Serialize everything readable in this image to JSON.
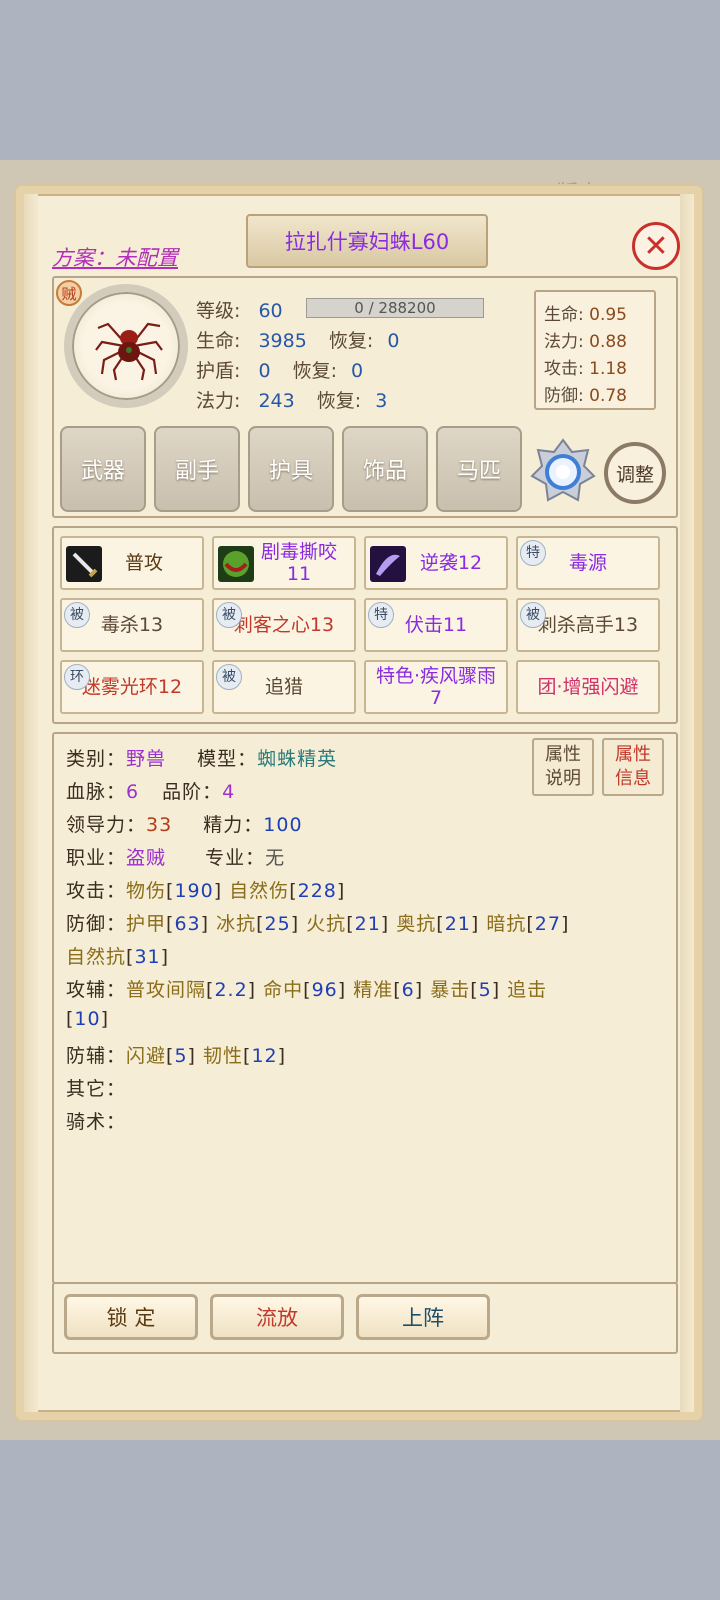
{
  "background": {
    "version_text": "版本0.0.0"
  },
  "header": {
    "plan_label": "方案：未配置",
    "title": "拉扎什寡妇蛛L60",
    "close_label": "✕"
  },
  "pet": {
    "role_badge": "贼",
    "level_label": "等级:",
    "level": "60",
    "exp_text": "0 / 288200",
    "hp_label": "生命:",
    "hp": "3985",
    "hp_regen_label": "恢复:",
    "hp_regen": "0",
    "shield_label": "护盾:",
    "shield": "0",
    "shield_regen_label": "恢复:",
    "shield_regen": "0",
    "mp_label": "法力:",
    "mp": "243",
    "mp_regen_label": "恢复:",
    "mp_regen": "3"
  },
  "growth": [
    {
      "label": "生命:",
      "value": "0.95"
    },
    {
      "label": "法力:",
      "value": "0.88"
    },
    {
      "label": "攻击:",
      "value": "1.18"
    },
    {
      "label": "防御:",
      "value": "0.78"
    }
  ],
  "equipment": {
    "slots": [
      "武器",
      "副手",
      "护具",
      "饰品",
      "马匹"
    ],
    "adjust_label": "调整"
  },
  "skills": [
    {
      "tag": "",
      "label": "普攻",
      "color": "#5c3a12"
    },
    {
      "tag": "",
      "label": "剧毒撕咬\n11",
      "color": "#8a2be2"
    },
    {
      "tag": "",
      "label": "逆袭12",
      "color": "#8a2be2"
    },
    {
      "tag": "特",
      "label": "毒源",
      "color": "#8a2be2"
    },
    {
      "tag": "被",
      "label": "毒杀13",
      "color": "#5c4a35"
    },
    {
      "tag": "被",
      "label": "刺客之心13",
      "color": "#c0392b"
    },
    {
      "tag": "特",
      "label": "伏击11",
      "color": "#8a2be2"
    },
    {
      "tag": "被",
      "label": "刺杀高手13",
      "color": "#5c4a35"
    },
    {
      "tag": "环",
      "label": "迷雾光环12",
      "color": "#c0392b"
    },
    {
      "tag": "被",
      "label": "追猎",
      "color": "#5c4a35"
    },
    {
      "tag": "",
      "label": "特色·疾风骤雨\n7",
      "color": "#8a2be2"
    },
    {
      "tag": "",
      "label": "团·增强闪避",
      "color": "#d0326a"
    }
  ],
  "attributes": {
    "category_label": "类别：",
    "category": "野兽",
    "model_label": "模型：",
    "model": "蜘蛛精英",
    "bloodline_label": "血脉：",
    "bloodline": "6",
    "rank_label": "品阶：",
    "rank": "4",
    "leadership_label": "领导力：",
    "leadership": "33",
    "energy_label": "精力：",
    "energy": "100",
    "class_label": "职业：",
    "class": "盗贼",
    "spec_label": "专业：",
    "spec": "无",
    "attack_label": "攻击：",
    "attack": [
      {
        "name": "物伤",
        "value": "190"
      },
      {
        "name": "自然伤",
        "value": "228"
      }
    ],
    "defense_label": "防御：",
    "defense": [
      {
        "name": "护甲",
        "value": "63"
      },
      {
        "name": "冰抗",
        "value": "25"
      },
      {
        "name": "火抗",
        "value": "21"
      },
      {
        "name": "奥抗",
        "value": "21"
      },
      {
        "name": "暗抗",
        "value": "27"
      },
      {
        "name": "自然抗",
        "value": "31"
      }
    ],
    "offense_aux_label": "攻辅：",
    "offense_aux": [
      {
        "name": "普攻间隔",
        "value": "2.2"
      },
      {
        "name": "命中",
        "value": "96"
      },
      {
        "name": "精准",
        "value": "6"
      },
      {
        "name": "暴击",
        "value": "5"
      },
      {
        "name": "追击",
        "value": "10"
      }
    ],
    "defense_aux_label": "防辅：",
    "defense_aux": [
      {
        "name": "闪避",
        "value": "5"
      },
      {
        "name": "韧性",
        "value": "12"
      }
    ],
    "other_label": "其它：",
    "riding_label": "骑术：",
    "attr_desc_btn": "属性\n说明",
    "attr_info_btn": "属性\n信息"
  },
  "actions": {
    "lock": "锁 定",
    "release": "流放",
    "deploy": "上阵"
  }
}
